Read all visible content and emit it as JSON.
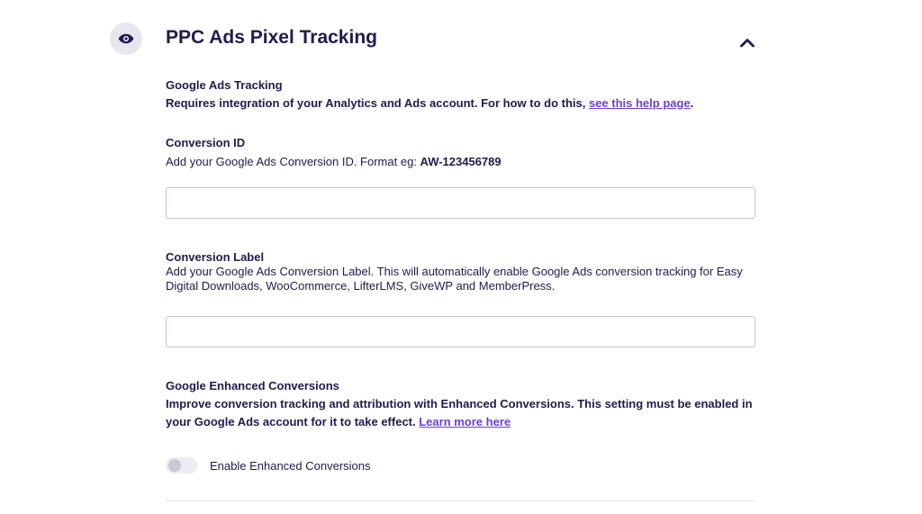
{
  "section": {
    "title": "PPC Ads Pixel Tracking",
    "icon": "eye-icon",
    "collapse_icon": "chevron-up-icon"
  },
  "google_ads_tracking": {
    "label": "Google Ads Tracking",
    "description_prefix": "Requires integration of your Analytics and Ads account. For how to do this, ",
    "link_text": "see this help page",
    "description_suffix": "."
  },
  "conversion_id": {
    "label": "Conversion ID",
    "description_prefix": "Add your Google Ads Conversion ID. Format eg: ",
    "format_example": "AW-123456789",
    "value": "",
    "placeholder": ""
  },
  "conversion_label": {
    "label": "Conversion Label",
    "description": "Add your Google Ads Conversion Label. This will automatically enable Google Ads conversion tracking for Easy Digital Downloads, WooCommerce, LifterLMS, GiveWP and MemberPress.",
    "value": "",
    "placeholder": ""
  },
  "enhanced_conversions": {
    "label": "Google Enhanced Conversions",
    "description": "Improve conversion tracking and attribution with Enhanced Conversions. This setting must be enabled in your Google Ads account for it to take effect. ",
    "link_text": "Learn more here",
    "toggle_label": "Enable Enhanced Conversions",
    "toggle_on": false
  },
  "colors": {
    "text": "#1f1b4d",
    "link": "#6b3fe0",
    "icon_bg": "#e6e6ee",
    "border": "#c3c3d4"
  }
}
